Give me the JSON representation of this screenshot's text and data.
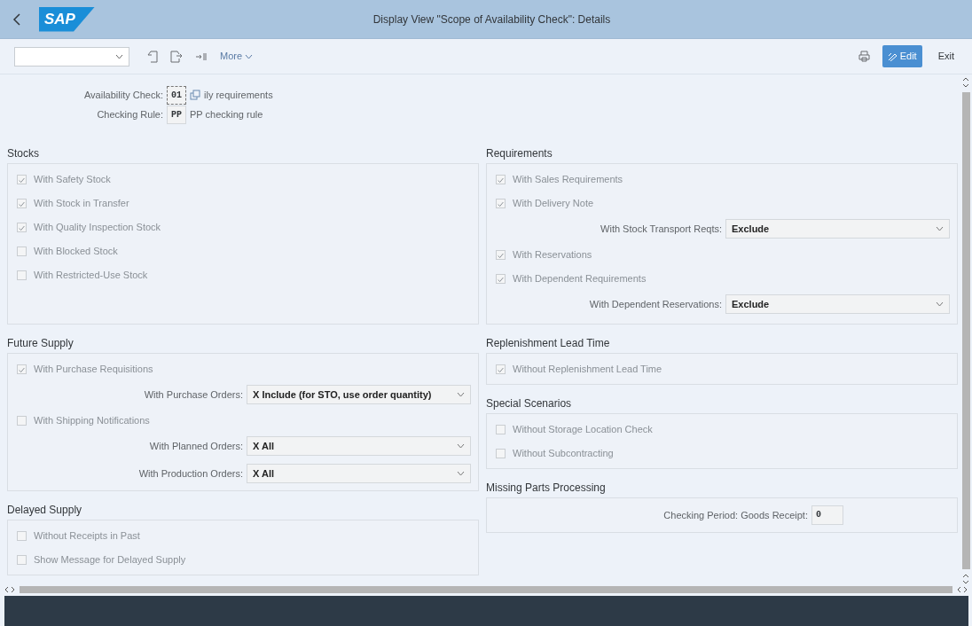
{
  "window": {
    "title": "Display View \"Scope of Availability Check\": Details",
    "logo_text": "SAP"
  },
  "toolbar": {
    "more_label": "More",
    "edit_label": "Edit",
    "exit_label": "Exit"
  },
  "header_fields": [
    {
      "label": "Availability Check:",
      "value": "01",
      "description": "ily requirements",
      "focused": true
    },
    {
      "label": "Checking Rule:",
      "value": "PP",
      "description": "PP checking rule",
      "focused": false
    }
  ],
  "left_sections": [
    {
      "title": "Stocks",
      "items": [
        {
          "kind": "checkbox",
          "label": "With Safety Stock",
          "checked": true
        },
        {
          "kind": "checkbox",
          "label": "With Stock in Transfer",
          "checked": true
        },
        {
          "kind": "checkbox",
          "label": "With Quality Inspection Stock",
          "checked": true
        },
        {
          "kind": "checkbox",
          "label": "With Blocked Stock",
          "checked": false
        },
        {
          "kind": "checkbox",
          "label": "With Restricted-Use Stock",
          "checked": false
        }
      ]
    },
    {
      "title": "Future Supply",
      "items": [
        {
          "kind": "checkbox",
          "label": "With Purchase Requisitions",
          "checked": true
        },
        {
          "kind": "select",
          "label": "With Purchase Orders:",
          "value": "X Include (for STO, use order quantity)"
        },
        {
          "kind": "checkbox",
          "label": "With Shipping Notifications",
          "checked": false
        },
        {
          "kind": "select",
          "label": "With Planned Orders:",
          "value": "X All"
        },
        {
          "kind": "select",
          "label": "With Production Orders:",
          "value": "X All"
        }
      ]
    },
    {
      "title": "Delayed Supply",
      "items": [
        {
          "kind": "checkbox",
          "label": "Without Receipts in Past",
          "checked": false
        },
        {
          "kind": "checkbox",
          "label": "Show Message for Delayed Supply",
          "checked": false
        }
      ]
    }
  ],
  "right_sections": [
    {
      "title": "Requirements",
      "items": [
        {
          "kind": "checkbox",
          "label": "With Sales Requirements",
          "checked": true
        },
        {
          "kind": "checkbox",
          "label": "With Delivery Note",
          "checked": true
        },
        {
          "kind": "select",
          "label": "With Stock Transport Reqts:",
          "value": "Exclude"
        },
        {
          "kind": "checkbox",
          "label": "With Reservations",
          "checked": true
        },
        {
          "kind": "checkbox",
          "label": "With Dependent Requirements",
          "checked": true
        },
        {
          "kind": "select",
          "label": "With Dependent Reservations:",
          "value": "Exclude"
        }
      ]
    },
    {
      "title": "Replenishment Lead Time",
      "items": [
        {
          "kind": "checkbox",
          "label": "Without Replenishment Lead Time",
          "checked": true
        }
      ]
    },
    {
      "title": "Special Scenarios",
      "items": [
        {
          "kind": "checkbox",
          "label": "Without Storage Location Check",
          "checked": false
        },
        {
          "kind": "checkbox",
          "label": "Without Subcontracting",
          "checked": false
        }
      ]
    },
    {
      "title": "Missing Parts Processing",
      "items": [
        {
          "kind": "number",
          "label": "Checking Period: Goods Receipt:",
          "value": "0"
        }
      ]
    }
  ]
}
